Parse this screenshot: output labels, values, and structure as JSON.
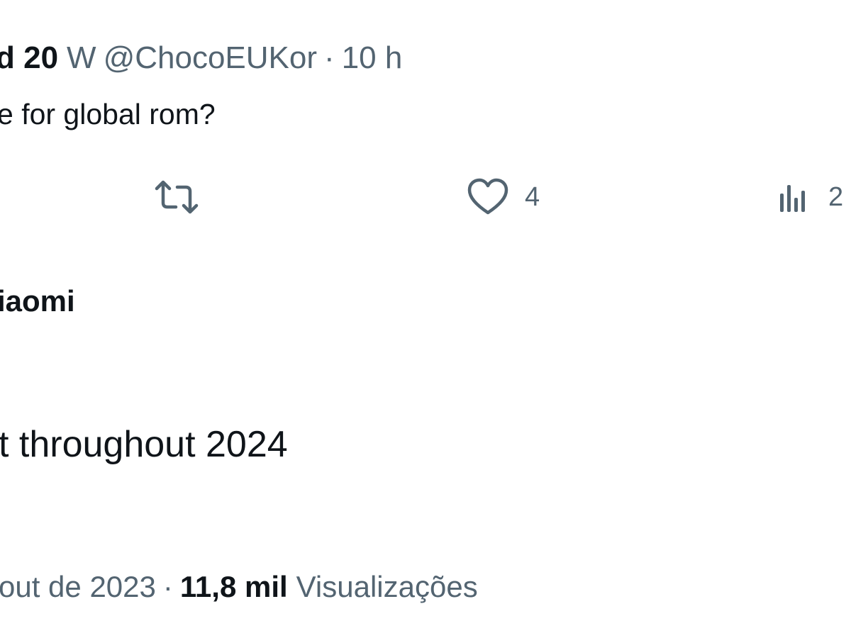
{
  "reply": {
    "display_name": "d 20",
    "name_suffix": "W",
    "handle": "@ChocoEUKor",
    "separator": "·",
    "time": "10 h",
    "text": "e for global rom?"
  },
  "actions": {
    "retweet_icon": "retweet-icon",
    "like_icon": "heart-icon",
    "like_count": "4",
    "views_icon": "analytics-icon",
    "views_count": "2"
  },
  "main_tweet": {
    "author": "iaomi",
    "text": "t throughout 2024",
    "date": "out de 2023",
    "separator": "·",
    "views_count": "11,8 mil",
    "views_label": "Visualizações"
  },
  "colors": {
    "text_primary": "#0f1419",
    "text_secondary": "#536471",
    "background": "#ffffff"
  }
}
